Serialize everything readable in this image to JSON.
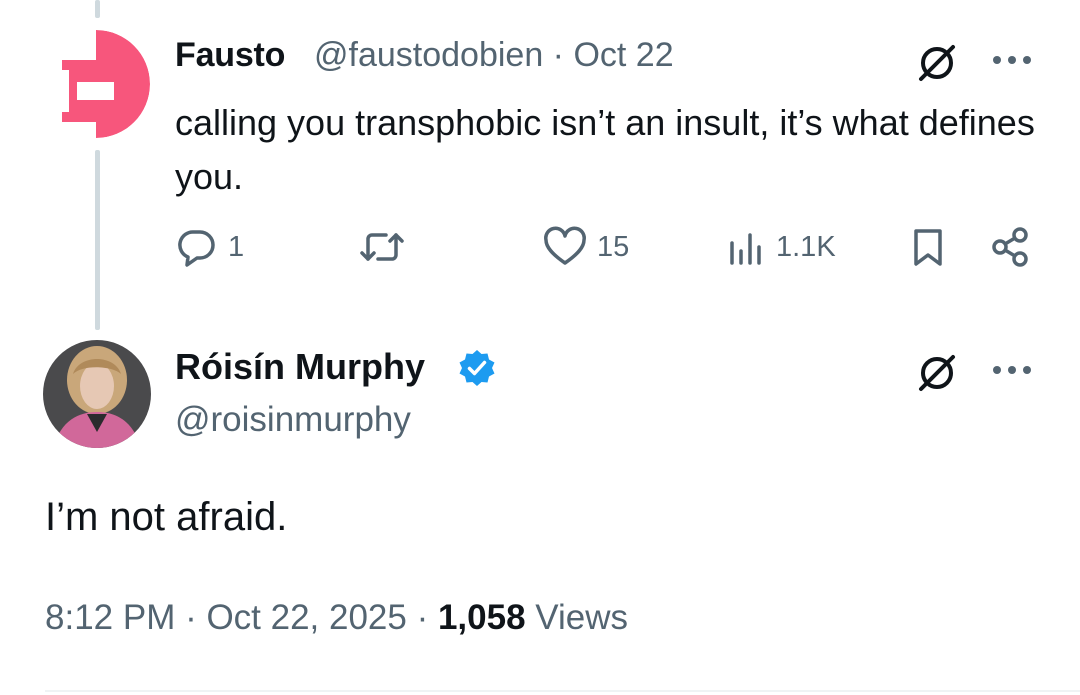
{
  "reply": {
    "author_name": "Fausto",
    "handle_date": "@faustodobien · Oct 22",
    "text": "calling you transphobic isn’t an insult, it’s what defines you.",
    "stats": {
      "replies": "1",
      "likes": "15",
      "views": "1.1K"
    },
    "avatar_color": "#f7567c"
  },
  "main_post": {
    "author_name": "Róisín Murphy",
    "handle": "@roisinmurphy",
    "text": "I’m not afraid.",
    "time": "8:12 PM · Oct 22, 2025 · ",
    "views_count": "1,058",
    "views_label": " Views",
    "verified_color": "#1d9bf0"
  },
  "icons": [
    "grok-icon",
    "more-icon",
    "reply-icon",
    "repost-icon",
    "like-icon",
    "views-icon",
    "bookmark-icon",
    "share-icon",
    "verified-badge-icon"
  ]
}
